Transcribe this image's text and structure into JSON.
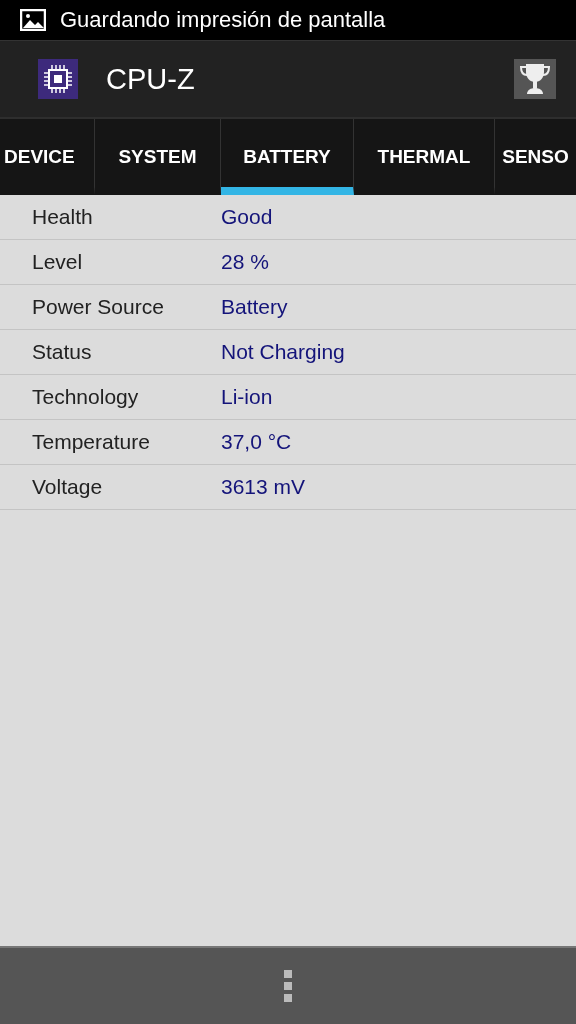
{
  "notification": {
    "text": "Guardando impresión de pantalla"
  },
  "app_bar": {
    "title": "CPU-Z"
  },
  "tabs": [
    {
      "label": "DEVICE",
      "selected": false
    },
    {
      "label": "SYSTEM",
      "selected": false
    },
    {
      "label": "BATTERY",
      "selected": true
    },
    {
      "label": "THERMAL",
      "selected": false
    },
    {
      "label": "SENSO",
      "selected": false
    }
  ],
  "rows": [
    {
      "label": "Health",
      "value": "Good"
    },
    {
      "label": "Level",
      "value": "28 %"
    },
    {
      "label": "Power Source",
      "value": "Battery"
    },
    {
      "label": "Status",
      "value": "Not Charging"
    },
    {
      "label": "Technology",
      "value": "Li-ion"
    },
    {
      "label": "Temperature",
      "value": "37,0 °C"
    },
    {
      "label": "Voltage",
      "value": "3613 mV"
    }
  ]
}
